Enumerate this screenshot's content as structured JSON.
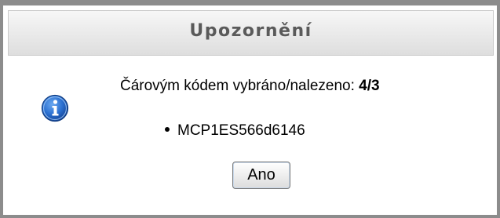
{
  "dialog": {
    "title": "Upozornění",
    "icon": "info-icon",
    "message_prefix": "Čárovým kódem vybráno/nalezeno: ",
    "message_count": "4/3",
    "items": [
      "MCP1ES566d6146"
    ],
    "ok_label": "Ano"
  },
  "colors": {
    "border": "#8c8c8c",
    "title_text": "#5a5a5a",
    "icon_blue": "#1d5fc4"
  }
}
